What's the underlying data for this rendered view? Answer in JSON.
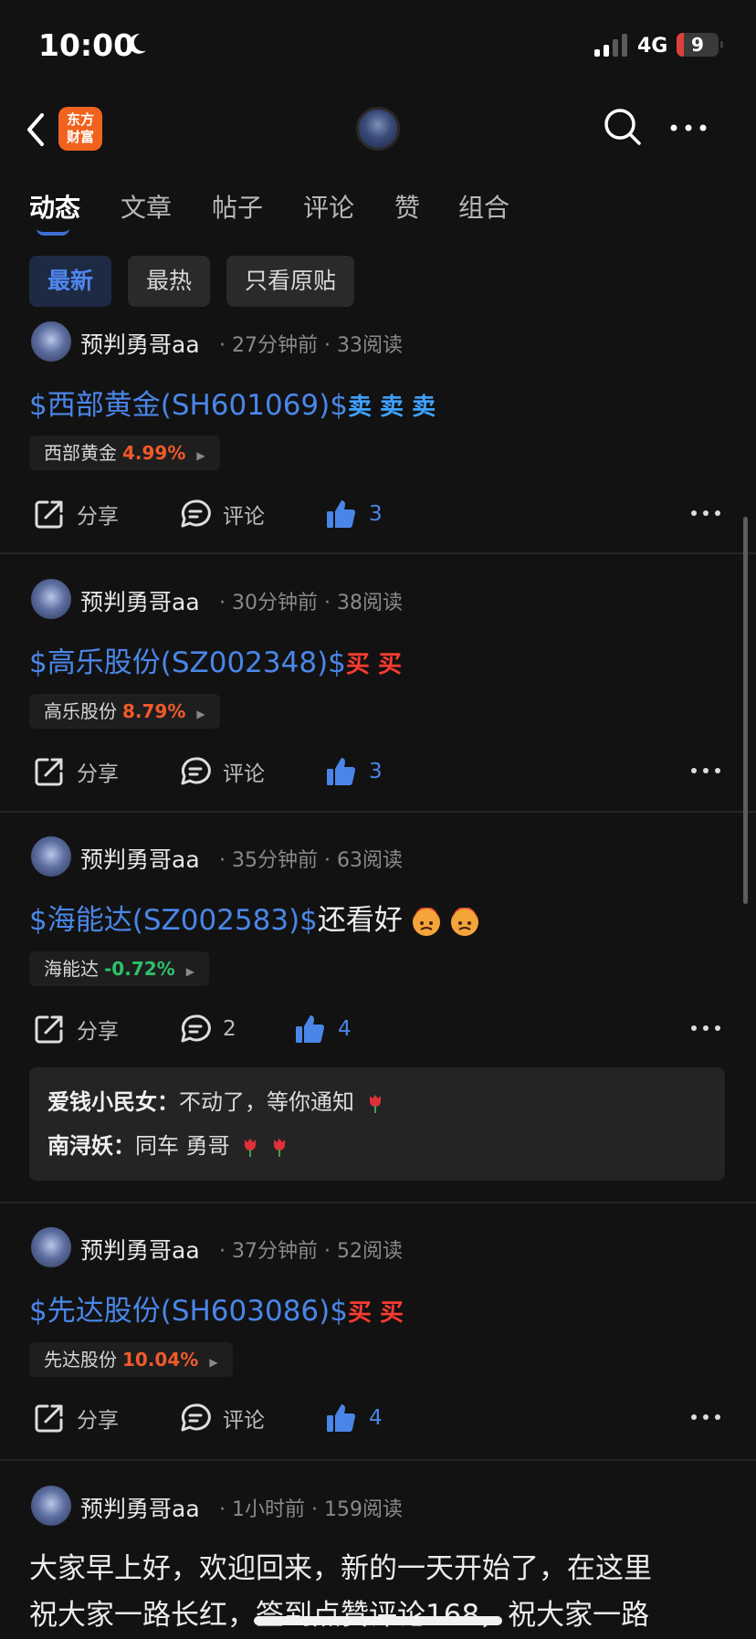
{
  "status_bar": {
    "time": "10:00",
    "network": "4G",
    "battery": "9"
  },
  "nav": {
    "logo_line1": "东方",
    "logo_line2": "财富"
  },
  "tabs": [
    "动态",
    "文章",
    "帖子",
    "评论",
    "赞",
    "组合"
  ],
  "filters": [
    "最新",
    "最热",
    "只看原贴"
  ],
  "posts": [
    {
      "author": "预判勇哥aa",
      "time": "27分钟前",
      "reads": "33阅读",
      "stock": "$西部黄金(SH601069)$",
      "tail": "卖 卖 卖",
      "quote_name": "西部黄金",
      "quote_change": "4.99%",
      "share": "分享",
      "comment": "评论",
      "likes": "3"
    },
    {
      "author": "预判勇哥aa",
      "time": "30分钟前",
      "reads": "38阅读",
      "stock": "$高乐股份(SZ002348)$",
      "tail": "买 买",
      "quote_name": "高乐股份",
      "quote_change": "8.79%",
      "share": "分享",
      "comment": "评论",
      "likes": "3"
    },
    {
      "author": "预判勇哥aa",
      "time": "35分钟前",
      "reads": "63阅读",
      "stock": "$海能达(SZ002583)$",
      "tail": "还看好",
      "quote_name": "海能达",
      "quote_change": "-0.72%",
      "share": "分享",
      "comment": "2",
      "likes": "4",
      "comments": [
        {
          "name": "爱钱小民女：",
          "text": "不动了，等你通知"
        },
        {
          "name": "南浔妖：",
          "text": "同车 勇哥"
        }
      ]
    },
    {
      "author": "预判勇哥aa",
      "time": "37分钟前",
      "reads": "52阅读",
      "stock": "$先达股份(SH603086)$",
      "tail": "买 买",
      "quote_name": "先达股份",
      "quote_change": "10.04%",
      "share": "分享",
      "comment": "评论",
      "likes": "4"
    },
    {
      "author": "预判勇哥aa",
      "time": "1小时前",
      "reads": "159阅读",
      "text_line1": "大家早上好，欢迎回来，新的一天开始了，在这里",
      "text_line2": "祝大家一路长红，签到点赞评论168，祝大家一路"
    }
  ],
  "colors": {
    "accent": "#4a86e8",
    "up": "#f05a2a",
    "down": "#2ec16a",
    "buy": "#ff3b30",
    "sell": "#3ea2ff"
  }
}
